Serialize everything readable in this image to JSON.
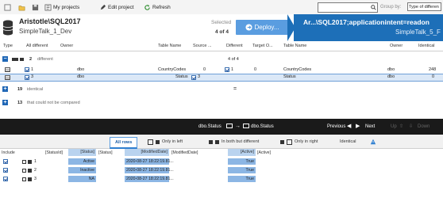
{
  "toolbar": {
    "my_projects": "My projects",
    "edit_project": "Edit project",
    "refresh": "Refresh",
    "search_value": "",
    "group_by_label": "Group by:",
    "group_by_value": "Type of differen"
  },
  "source": {
    "server": "Aristotle\\SQL2017",
    "database": "SimpleTalk_1_Dev"
  },
  "selection": {
    "label": "Selected",
    "count": "4 of 4"
  },
  "deploy_button": "Deploy...",
  "target": {
    "server": "Ar...\\SQL2017;applicationintent=readon",
    "database": "SimpleTalk_5_F"
  },
  "columns": {
    "type": "Type",
    "all_different": "All different",
    "owner": "Owner",
    "table_name": "Table Name",
    "source_o": "Source ...",
    "different": "Different",
    "target_o": "Target O...",
    "table_name_2": "Table Name",
    "owner_2": "Owner",
    "identical": "Identical"
  },
  "groups": [
    {
      "sign": "−",
      "count": "2",
      "label": "different",
      "mid": "4 of 4"
    },
    {
      "sign": "+",
      "count": "19",
      "label": "identical",
      "mid": "="
    },
    {
      "sign": "+",
      "count": "13",
      "label": "that could not be compared",
      "mid": ""
    }
  ],
  "objects": [
    {
      "num": "1",
      "owner": "dbo",
      "name": "CountryCodes",
      "src_count": "0",
      "diff": "1",
      "tgt_count": "0",
      "tgt_name": "CountryCodes",
      "tgt_owner": "dbo",
      "identical": "248"
    },
    {
      "num": "3",
      "owner": "dbo",
      "name": "Status",
      "src_count": "3",
      "diff": "",
      "tgt_count": "",
      "tgt_name": "Status",
      "tgt_owner": "dbo",
      "identical": "0"
    }
  ],
  "pane": {
    "left_object": "dbo.Status",
    "right_object": "dbo.Status",
    "previous": "Previous",
    "next": "Next",
    "up": "Up",
    "down": "Down"
  },
  "tabs": {
    "all_rows": "All rows",
    "only_left": "Only in left",
    "both_diff": "In both but different",
    "only_right": "Only in right",
    "identical": "Identical"
  },
  "data_columns": {
    "include": "Include",
    "statusid": "[StatusId]",
    "status": "[Status]",
    "status_r": "[Status]",
    "modified": "[ModifiedDate]",
    "modified_r": "[ModifiedDate]",
    "active": "[Active]",
    "active_r": "[Active]"
  },
  "data_rows": [
    {
      "id": "1",
      "status": "Active",
      "modified": "2020-08-27 18:22:19.81...",
      "active": "True"
    },
    {
      "id": "2",
      "status": "Inactive",
      "modified": "2020-08-27 18:22:19.81...",
      "active": "True"
    },
    {
      "id": "3",
      "status": "NA",
      "modified": "2020-08-27 18:22:19.81...",
      "active": "True"
    }
  ],
  "colors": {
    "accent": "#1d6fb8",
    "deploy": "#5a9de0",
    "highlight": "#8cb6e4"
  }
}
